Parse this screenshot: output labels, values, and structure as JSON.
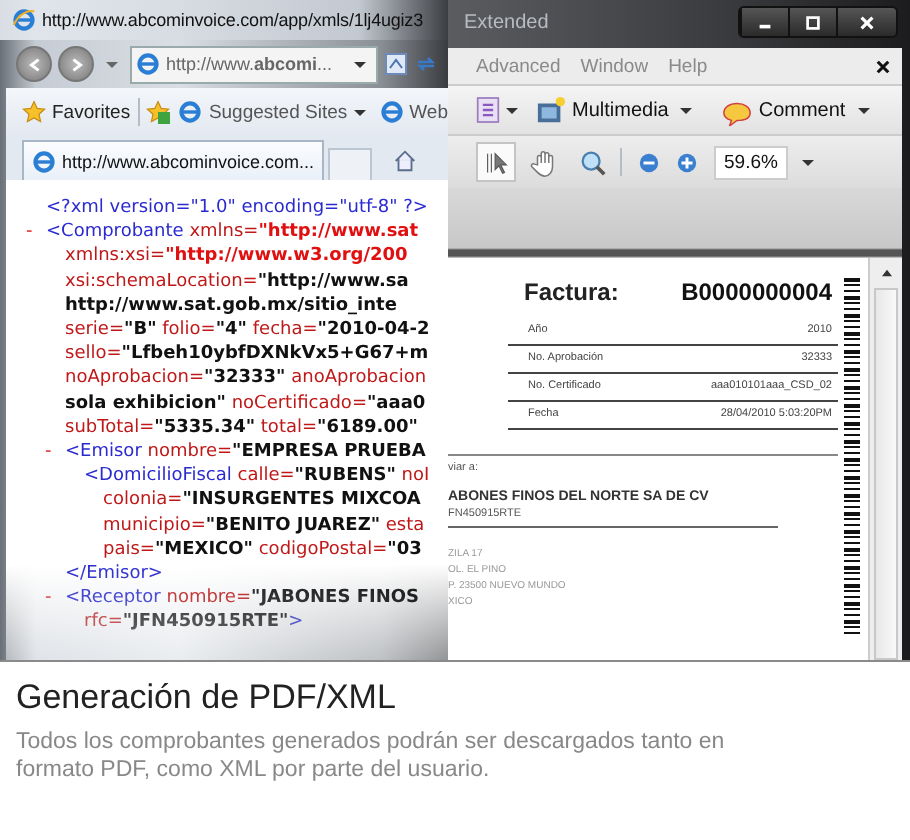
{
  "browser": {
    "title": "http://www.abcominvoice.com/app/xmls/1lj4ugiz3",
    "address": "http://www.**abcomi**...",
    "favorites_label": "Favorites",
    "favorites_links": [
      {
        "label": "Suggested Sites",
        "dropdown": true
      },
      {
        "label": "Web",
        "dropdown": false
      }
    ],
    "tab": {
      "title": "http://www.abcominvoice.com..."
    },
    "xml": [
      {
        "segments": [
          {
            "kind": "tag",
            "text": "<?xml version=\"1.0\" encoding=\"utf-8\" ?>"
          }
        ]
      },
      {
        "toggle": "-",
        "segments": [
          {
            "kind": "tag",
            "text": "<Comprobante"
          },
          {
            "kind": "attr",
            "text": " xmlns="
          },
          {
            "kind": "url",
            "text": "\"http://www.sat"
          }
        ],
        "lines": [
          [
            {
              "kind": "attr",
              "text": "xmlns:xsi="
            },
            {
              "kind": "url",
              "text": "\"http://www.w3.org/200"
            }
          ],
          [
            {
              "kind": "attr",
              "text": "xsi:schemaLocation="
            },
            {
              "kind": "value",
              "text": "\"http://www.sa"
            }
          ],
          [
            {
              "kind": "value",
              "text": "http://www.sat.gob.mx/sitio_inte"
            }
          ],
          [
            {
              "kind": "attr",
              "text": "serie="
            },
            {
              "kind": "value",
              "text": "\"B\""
            },
            {
              "kind": "attr",
              "text": " folio="
            },
            {
              "kind": "value",
              "text": "\"4\""
            },
            {
              "kind": "attr",
              "text": " fecha="
            },
            {
              "kind": "value",
              "text": "\"2010-04-2"
            }
          ],
          [
            {
              "kind": "attr",
              "text": "sello="
            },
            {
              "kind": "value",
              "text": "\"Lfbeh10ybfDXNkVx5+G67+m"
            }
          ],
          [
            {
              "kind": "attr",
              "text": "noAprobacion="
            },
            {
              "kind": "value",
              "text": "\"32333\""
            },
            {
              "kind": "attr",
              "text": " anoAprobacion"
            }
          ],
          [
            {
              "kind": "value",
              "text": "sola exhibicion\""
            },
            {
              "kind": "attr",
              "text": " noCertificado="
            },
            {
              "kind": "value",
              "text": "\"aaa0"
            }
          ],
          [
            {
              "kind": "attr",
              "text": "subTotal="
            },
            {
              "kind": "value",
              "text": "\"5335.34\""
            },
            {
              "kind": "attr",
              "text": " total="
            },
            {
              "kind": "value",
              "text": "\"6189.00\""
            }
          ]
        ],
        "children": [
          {
            "toggle": "-",
            "segments": [
              {
                "kind": "tag",
                "text": "<Emisor"
              },
              {
                "kind": "attr",
                "text": " nombre="
              },
              {
                "kind": "value",
                "text": "\"EMPRESA PRUEBA"
              }
            ],
            "children": [
              {
                "segments": [
                  {
                    "kind": "tag",
                    "text": "<DomicilioFiscal"
                  },
                  {
                    "kind": "attr",
                    "text": " calle="
                  },
                  {
                    "kind": "value",
                    "text": "\"RUBENS\""
                  },
                  {
                    "kind": "attr",
                    "text": " noI"
                  }
                ],
                "lines": [
                  [
                    {
                      "kind": "attr",
                      "text": "colonia="
                    },
                    {
                      "kind": "value",
                      "text": "\"INSURGENTES MIXCOA"
                    }
                  ],
                  [
                    {
                      "kind": "attr",
                      "text": "municipio="
                    },
                    {
                      "kind": "value",
                      "text": "\"BENITO JUAREZ\""
                    },
                    {
                      "kind": "attr",
                      "text": " esta"
                    }
                  ],
                  [
                    {
                      "kind": "attr",
                      "text": "pais="
                    },
                    {
                      "kind": "value",
                      "text": "\"MEXICO\""
                    },
                    {
                      "kind": "attr",
                      "text": " codigoPostal="
                    },
                    {
                      "kind": "value",
                      "text": "\"03"
                    }
                  ]
                ]
              }
            ],
            "close": [
              {
                "kind": "tag",
                "text": "</Emisor>"
              }
            ]
          },
          {
            "toggle": "-",
            "segments": [
              {
                "kind": "tag",
                "text": "<Receptor"
              },
              {
                "kind": "attr",
                "text": " nombre="
              },
              {
                "kind": "value",
                "text": "\"JABONES FINOS"
              }
            ],
            "lines": [
              [
                {
                  "kind": "attr",
                  "text": "rfc="
                },
                {
                  "kind": "value",
                  "text": "\"JFN450915RTE\""
                },
                {
                  "kind": "tag",
                  "text": ">"
                }
              ]
            ]
          }
        ]
      }
    ]
  },
  "reader": {
    "title": "Extended",
    "menu": [
      "Advanced",
      "Window",
      "Help"
    ],
    "toolbar": [
      {
        "label": "Multimedia",
        "kind": "media"
      },
      {
        "label": "Comment",
        "kind": "comment"
      }
    ],
    "tools": [
      {
        "kind": "select",
        "selected": true
      },
      {
        "kind": "hand",
        "selected": false
      },
      {
        "kind": "zoom",
        "selected": false
      }
    ],
    "zoom_value": "59.6%",
    "document": {
      "title_label": "Factura:",
      "number": "B0000000004",
      "fields": [
        {
          "label": "Año",
          "value": "2010"
        },
        {
          "label": "No. Aprobación",
          "value": "32333"
        },
        {
          "label": "No. Certificado",
          "value": "aaa010101aaa_CSD_02"
        },
        {
          "label": "Fecha",
          "value": "28/04/2010 5:03:20PM"
        }
      ],
      "ship_to_label": "viar a:",
      "customer_name": "ABONES FINOS DEL NORTE SA DE CV",
      "customer_rfc": "FN450915RTE",
      "address_lines": [
        "ZILA 17",
        "OL. EL PINO",
        "P. 23500 NUEVO MUNDO",
        "XICO"
      ]
    }
  },
  "caption": {
    "title": "Generación de PDF/XML",
    "description": "Todos los comprobantes generados podrán ser descargados tanto en formato PDF, como XML por parte del usuario."
  }
}
